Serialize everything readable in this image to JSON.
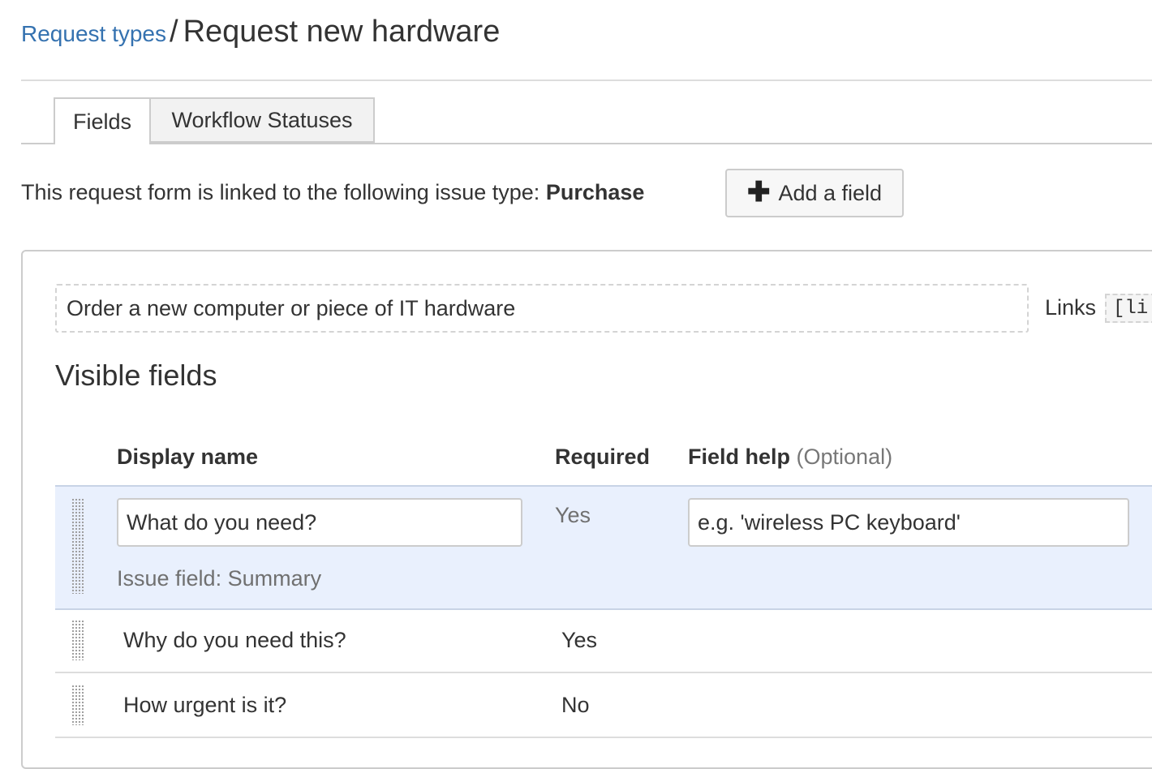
{
  "breadcrumb": {
    "parent_label": "Request types",
    "separator": "/",
    "title": "Request new hardware"
  },
  "tabs": [
    {
      "label": "Fields",
      "active": true
    },
    {
      "label": "Workflow Statuses",
      "active": false
    }
  ],
  "issue_type": {
    "prefix": "This request form is linked to the following issue type:",
    "value": "Purchase"
  },
  "add_field_button": {
    "icon": "plus-icon",
    "label": "Add a field"
  },
  "description": {
    "value": "Order a new computer or piece of IT hardware"
  },
  "links": {
    "label": "Links",
    "code": "[li"
  },
  "visible_fields": {
    "title": "Visible fields",
    "columns": {
      "display_name": "Display name",
      "required": "Required",
      "field_help": "Field help",
      "field_help_optional": "(Optional)"
    },
    "rows": [
      {
        "display_name": "What do you need?",
        "required": "Yes",
        "field_help": "e.g. 'wireless PC keyboard'",
        "issue_field": "Issue field: Summary",
        "editing": true
      },
      {
        "display_name": "Why do you need this?",
        "required": "Yes"
      },
      {
        "display_name": "How urgent is it?",
        "required": "No"
      }
    ]
  },
  "colors": {
    "link": "#3572b0",
    "selected_row": "#e9f0fd",
    "tab_inactive": "#f2f2f2"
  }
}
